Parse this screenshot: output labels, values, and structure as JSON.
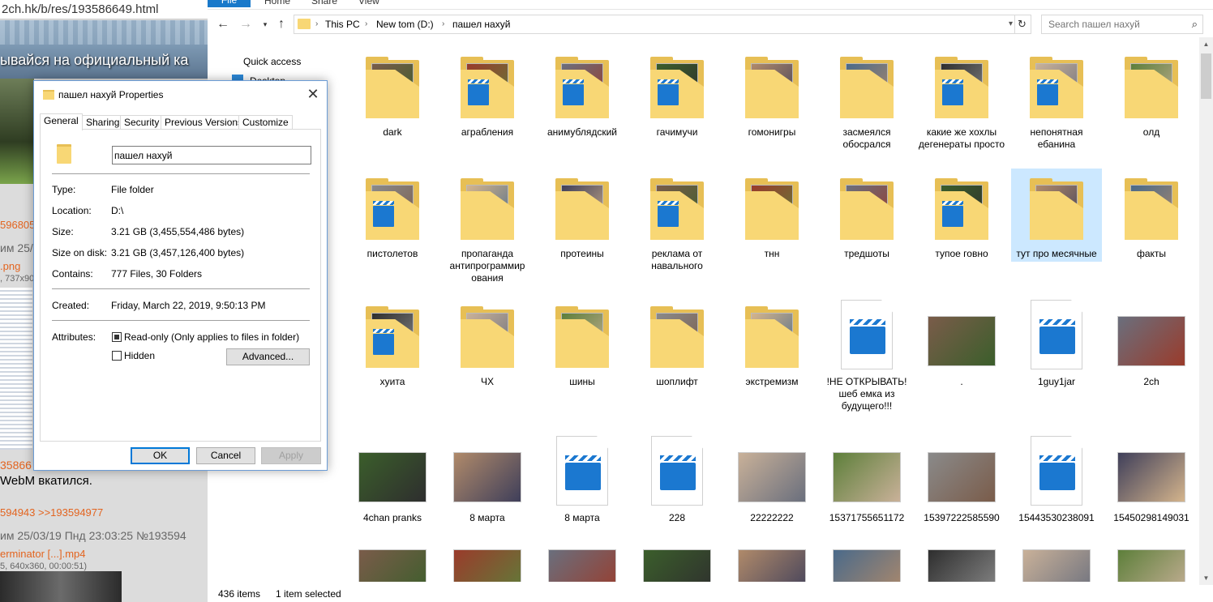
{
  "browser": {
    "url": "2ch.hk/b/res/193586649.html",
    "banner_text": "ывайся на официальный ка",
    "post_id_orange": "596805",
    "post_date_1": "им 25/",
    "file_link_1": ".png",
    "file_meta_1": ", 737x90",
    "post_id_orange_2": "35866",
    "post_text": "WebM вкатился.",
    "reply_links": "594943 >>193594977",
    "post_date_2": "им 25/03/19 Пнд 23:03:25  №193594",
    "file_link_2": "erminator [...].mp4",
    "file_meta_2": "5, 640x360, 00:00:51)"
  },
  "ribbon": {
    "file": "File",
    "home": "Home",
    "share": "Share",
    "view": "View"
  },
  "address": {
    "crumbs": [
      "This PC",
      "New tom (D:)",
      "пашел нахуй"
    ]
  },
  "search": {
    "placeholder": "Search пашел нахуй"
  },
  "navpane": {
    "quick_access": "Quick access",
    "desktop": "Desktop"
  },
  "items": [
    {
      "label": "dark",
      "kind": "folder"
    },
    {
      "label": "аграбления",
      "kind": "folder-video"
    },
    {
      "label": "анимублядский",
      "kind": "folder-video"
    },
    {
      "label": "гачимучи",
      "kind": "folder-video"
    },
    {
      "label": "гомонигры",
      "kind": "folder"
    },
    {
      "label": "засмеялся обосрался",
      "kind": "folder"
    },
    {
      "label": "какие же хохлы дегенераты просто",
      "kind": "folder-video"
    },
    {
      "label": "непонятная ебанина",
      "kind": "folder-video"
    },
    {
      "label": "олд",
      "kind": "folder"
    },
    {
      "label": "пистолетов",
      "kind": "folder-video"
    },
    {
      "label": "пропаганда антипрограммир ования",
      "kind": "folder"
    },
    {
      "label": "протеины",
      "kind": "folder"
    },
    {
      "label": "реклама от навального",
      "kind": "folder-video"
    },
    {
      "label": "тнн",
      "kind": "folder"
    },
    {
      "label": "тредшоты",
      "kind": "folder"
    },
    {
      "label": "тупое говно",
      "kind": "folder-video"
    },
    {
      "label": "тут про месячные",
      "kind": "folder",
      "selected": true
    },
    {
      "label": "факты",
      "kind": "folder"
    },
    {
      "label": "хуита",
      "kind": "folder-video"
    },
    {
      "label": "ЧХ",
      "kind": "folder"
    },
    {
      "label": "шины",
      "kind": "folder"
    },
    {
      "label": "шоплифт",
      "kind": "folder"
    },
    {
      "label": "экстремизм",
      "kind": "folder"
    },
    {
      "label": "!НЕ ОТКРЫВАТЬ!шеб емка из будущего!!!",
      "kind": "video"
    },
    {
      "label": ".",
      "kind": "image"
    },
    {
      "label": "1guy1jar",
      "kind": "video"
    },
    {
      "label": "2ch",
      "kind": "image"
    },
    {
      "label": "4chan pranks",
      "kind": "image"
    },
    {
      "label": "8 марта",
      "kind": "image"
    },
    {
      "label": "8 марта",
      "kind": "video"
    },
    {
      "label": "228",
      "kind": "video"
    },
    {
      "label": "22222222",
      "kind": "image"
    },
    {
      "label": "15371755651172",
      "kind": "image"
    },
    {
      "label": "15397222585590",
      "kind": "image"
    },
    {
      "label": "15443530238091",
      "kind": "video"
    },
    {
      "label": "15450298149031",
      "kind": "image"
    },
    {
      "label": "",
      "kind": "image"
    },
    {
      "label": "",
      "kind": "image"
    },
    {
      "label": "",
      "kind": "image"
    },
    {
      "label": "",
      "kind": "image"
    },
    {
      "label": "",
      "kind": "image"
    },
    {
      "label": "",
      "kind": "image"
    },
    {
      "label": "",
      "kind": "image"
    },
    {
      "label": "",
      "kind": "image"
    },
    {
      "label": "",
      "kind": "image"
    }
  ],
  "status": {
    "count": "436 items",
    "selected": "1 item selected"
  },
  "props": {
    "title": "пашел нахуй Properties",
    "tabs": [
      "General",
      "Sharing",
      "Security",
      "Previous Versions",
      "Customize"
    ],
    "name": "пашел нахуй",
    "type_label": "Type:",
    "type_value": "File folder",
    "location_label": "Location:",
    "location_value": "D:\\",
    "size_label": "Size:",
    "size_value": "3.21 GB (3,455,554,486 bytes)",
    "size_on_disk_label": "Size on disk:",
    "size_on_disk_value": "3.21 GB (3,457,126,400 bytes)",
    "contains_label": "Contains:",
    "contains_value": "777 Files, 30 Folders",
    "created_label": "Created:",
    "created_value": "Friday, March 22, 2019, 9:50:13 PM",
    "attributes_label": "Attributes:",
    "readonly_label": "Read-only (Only applies to files in folder)",
    "hidden_label": "Hidden",
    "advanced_label": "Advanced...",
    "ok": "OK",
    "cancel": "Cancel",
    "apply": "Apply"
  }
}
